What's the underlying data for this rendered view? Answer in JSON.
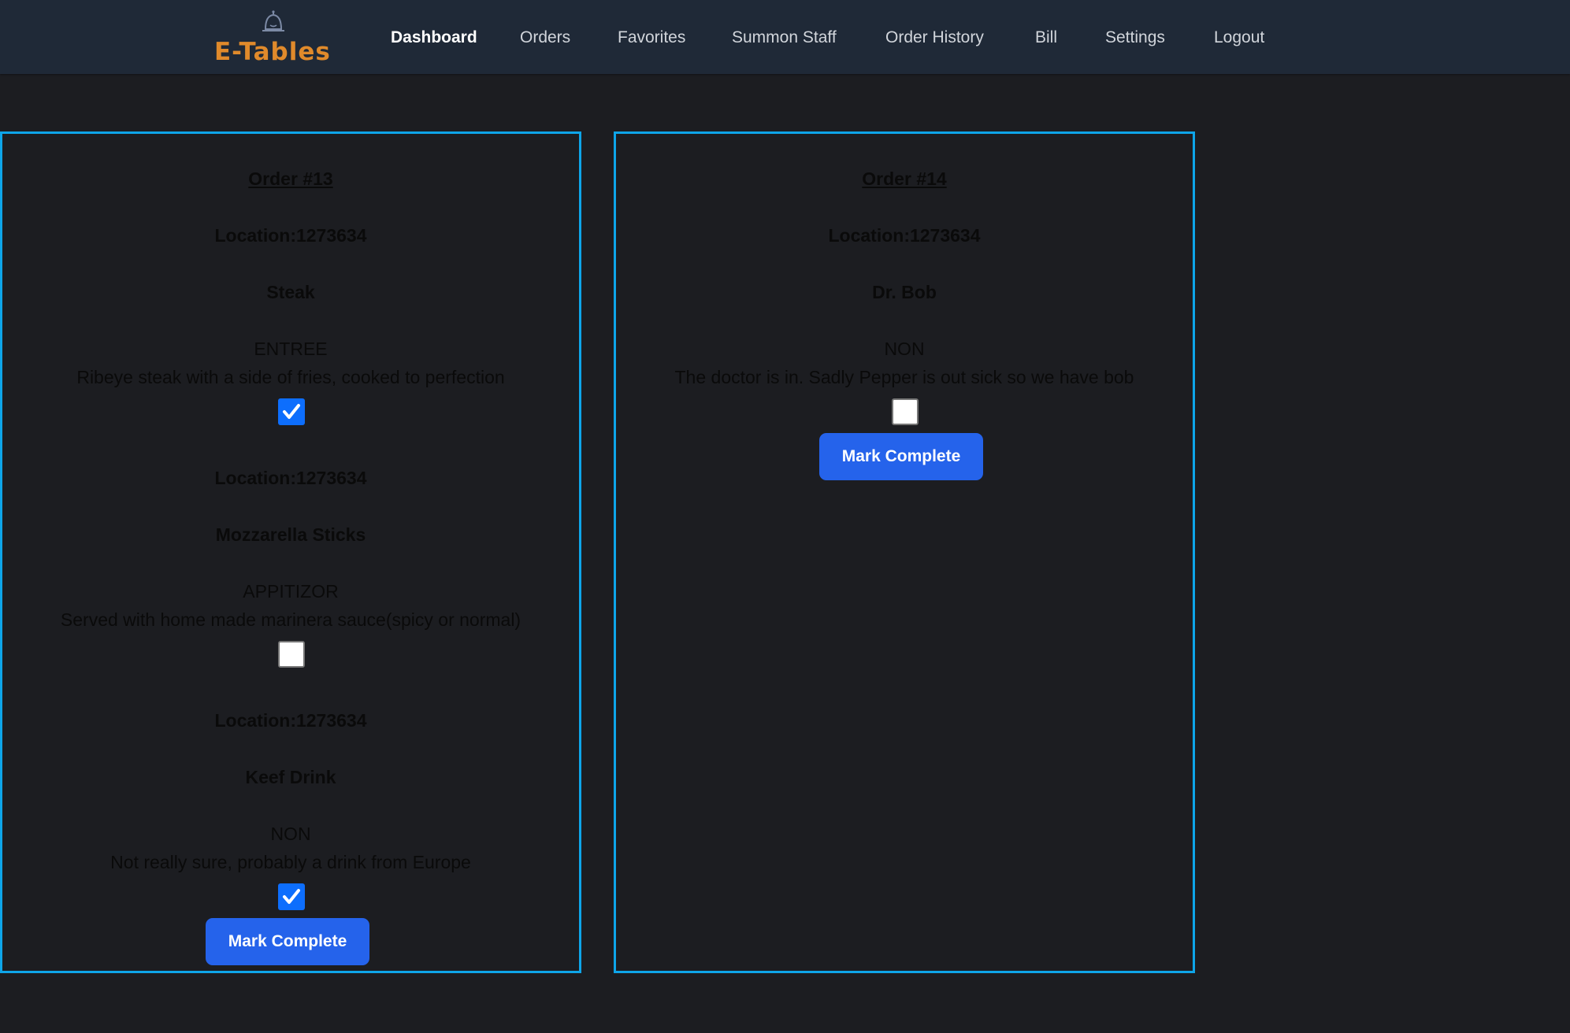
{
  "brand": {
    "logo_text": "E-Tables",
    "logo_color": "#e08a2b"
  },
  "nav": {
    "items": [
      {
        "label": "Dashboard",
        "active": true
      },
      {
        "label": "Orders"
      },
      {
        "label": "Favorites"
      },
      {
        "label": "Summon Staff"
      },
      {
        "label": "Order History"
      },
      {
        "label": "Bill"
      },
      {
        "label": "Settings"
      },
      {
        "label": "Logout"
      }
    ]
  },
  "orders": [
    {
      "title": "Order #13",
      "items": [
        {
          "location": "Location:1273634",
          "name": "Steak",
          "category": "ENTREE",
          "description": "Ribeye steak with a side of fries, cooked to perfection",
          "checked": true
        },
        {
          "location": "Location:1273634",
          "name": "Mozzarella Sticks",
          "category": "APPITIZOR",
          "description": "Served with home made marinera sauce(spicy or normal)",
          "checked": false
        },
        {
          "location": "Location:1273634",
          "name": "Keef Drink",
          "category": "NON",
          "description": "Not really sure, probably a drink from Europe",
          "checked": true
        }
      ],
      "button_label": "Mark Complete"
    },
    {
      "title": "Order #14",
      "items": [
        {
          "location": "Location:1273634",
          "name": "Dr. Bob",
          "category": "NON",
          "description": "The doctor is in. Sadly Pepper is out sick so we have bob",
          "checked": false
        }
      ],
      "button_label": "Mark Complete"
    }
  ],
  "colors": {
    "background": "#1c1d21",
    "navbar": "#1f2937",
    "card_border": "#0ea5e9",
    "button": "#2563eb",
    "checkbox_checked": "#0d6efd"
  }
}
